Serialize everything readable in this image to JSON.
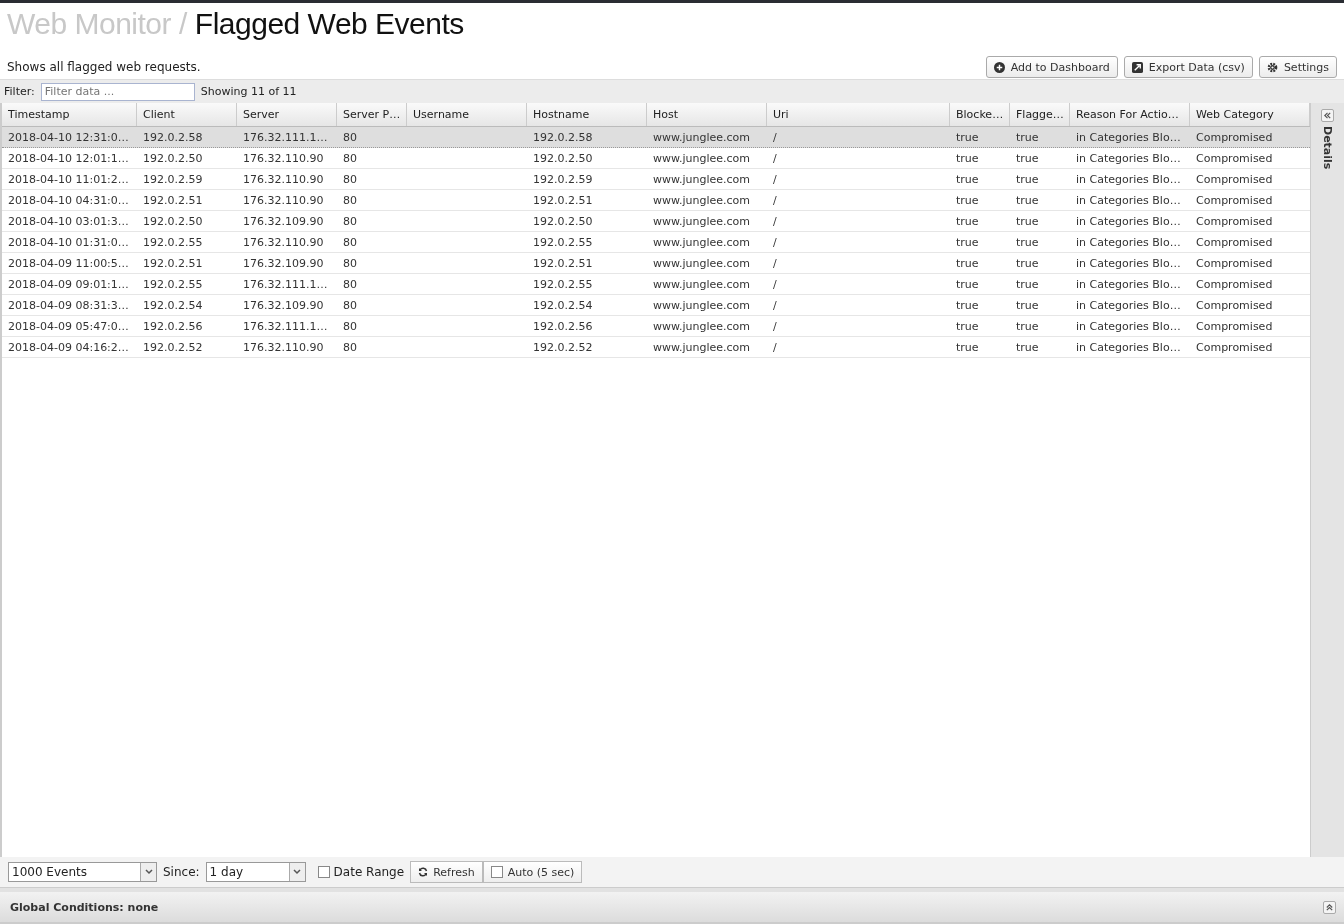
{
  "breadcrumb": {
    "parent": "Web Monitor",
    "separator": "/",
    "title": "Flagged Web Events"
  },
  "description": "Shows all flagged web requests.",
  "actions": [
    {
      "kind": "dashboard",
      "label": "Add to Dashboard"
    },
    {
      "kind": "export",
      "label": "Export Data (csv)"
    },
    {
      "kind": "settings",
      "label": "Settings"
    }
  ],
  "filter": {
    "label": "Filter:",
    "placeholder": "Filter data ...",
    "count": "Showing 11 of 11"
  },
  "table": {
    "columns": [
      "Timestamp",
      "Client",
      "Server",
      "Server P…",
      "Username",
      "Hostname",
      "Host",
      "Uri",
      "Blocke…",
      "Flagge…",
      "Reason For Actio…",
      "Web Category"
    ],
    "rows": [
      {
        "selected": true,
        "cells": [
          "2018-04-10 12:31:0…",
          "192.0.2.58",
          "176.32.111.1…",
          "80",
          "",
          "192.0.2.58",
          "www.junglee.com",
          "/",
          "true",
          "true",
          "in Categories Blo…",
          "Compromised"
        ]
      },
      {
        "selected": false,
        "cells": [
          "2018-04-10 12:01:1…",
          "192.0.2.50",
          "176.32.110.90",
          "80",
          "",
          "192.0.2.50",
          "www.junglee.com",
          "/",
          "true",
          "true",
          "in Categories Blo…",
          "Compromised"
        ]
      },
      {
        "selected": false,
        "cells": [
          "2018-04-10 11:01:2…",
          "192.0.2.59",
          "176.32.110.90",
          "80",
          "",
          "192.0.2.59",
          "www.junglee.com",
          "/",
          "true",
          "true",
          "in Categories Blo…",
          "Compromised"
        ]
      },
      {
        "selected": false,
        "cells": [
          "2018-04-10 04:31:0…",
          "192.0.2.51",
          "176.32.110.90",
          "80",
          "",
          "192.0.2.51",
          "www.junglee.com",
          "/",
          "true",
          "true",
          "in Categories Blo…",
          "Compromised"
        ]
      },
      {
        "selected": false,
        "cells": [
          "2018-04-10 03:01:3…",
          "192.0.2.50",
          "176.32.109.90",
          "80",
          "",
          "192.0.2.50",
          "www.junglee.com",
          "/",
          "true",
          "true",
          "in Categories Blo…",
          "Compromised"
        ]
      },
      {
        "selected": false,
        "cells": [
          "2018-04-10 01:31:0…",
          "192.0.2.55",
          "176.32.110.90",
          "80",
          "",
          "192.0.2.55",
          "www.junglee.com",
          "/",
          "true",
          "true",
          "in Categories Blo…",
          "Compromised"
        ]
      },
      {
        "selected": false,
        "cells": [
          "2018-04-09 11:00:5…",
          "192.0.2.51",
          "176.32.109.90",
          "80",
          "",
          "192.0.2.51",
          "www.junglee.com",
          "/",
          "true",
          "true",
          "in Categories Blo…",
          "Compromised"
        ]
      },
      {
        "selected": false,
        "cells": [
          "2018-04-09 09:01:1…",
          "192.0.2.55",
          "176.32.111.1…",
          "80",
          "",
          "192.0.2.55",
          "www.junglee.com",
          "/",
          "true",
          "true",
          "in Categories Blo…",
          "Compromised"
        ]
      },
      {
        "selected": false,
        "cells": [
          "2018-04-09 08:31:3…",
          "192.0.2.54",
          "176.32.109.90",
          "80",
          "",
          "192.0.2.54",
          "www.junglee.com",
          "/",
          "true",
          "true",
          "in Categories Blo…",
          "Compromised"
        ]
      },
      {
        "selected": false,
        "cells": [
          "2018-04-09 05:47:0…",
          "192.0.2.56",
          "176.32.111.1…",
          "80",
          "",
          "192.0.2.56",
          "www.junglee.com",
          "/",
          "true",
          "true",
          "in Categories Blo…",
          "Compromised"
        ]
      },
      {
        "selected": false,
        "cells": [
          "2018-04-09 04:16:2…",
          "192.0.2.52",
          "176.32.110.90",
          "80",
          "",
          "192.0.2.52",
          "www.junglee.com",
          "/",
          "true",
          "true",
          "in Categories Blo…",
          "Compromised"
        ]
      }
    ]
  },
  "details_panel": {
    "label": "Details",
    "expanded": false
  },
  "toolbar": {
    "limit": "1000 Events",
    "since_label": "Since:",
    "since": "1 day",
    "date_range": {
      "label": "Date Range",
      "checked": false
    },
    "refresh": "Refresh",
    "auto": {
      "label": "Auto (5 sec)",
      "checked": false
    }
  },
  "global_conditions": "Global Conditions: none"
}
